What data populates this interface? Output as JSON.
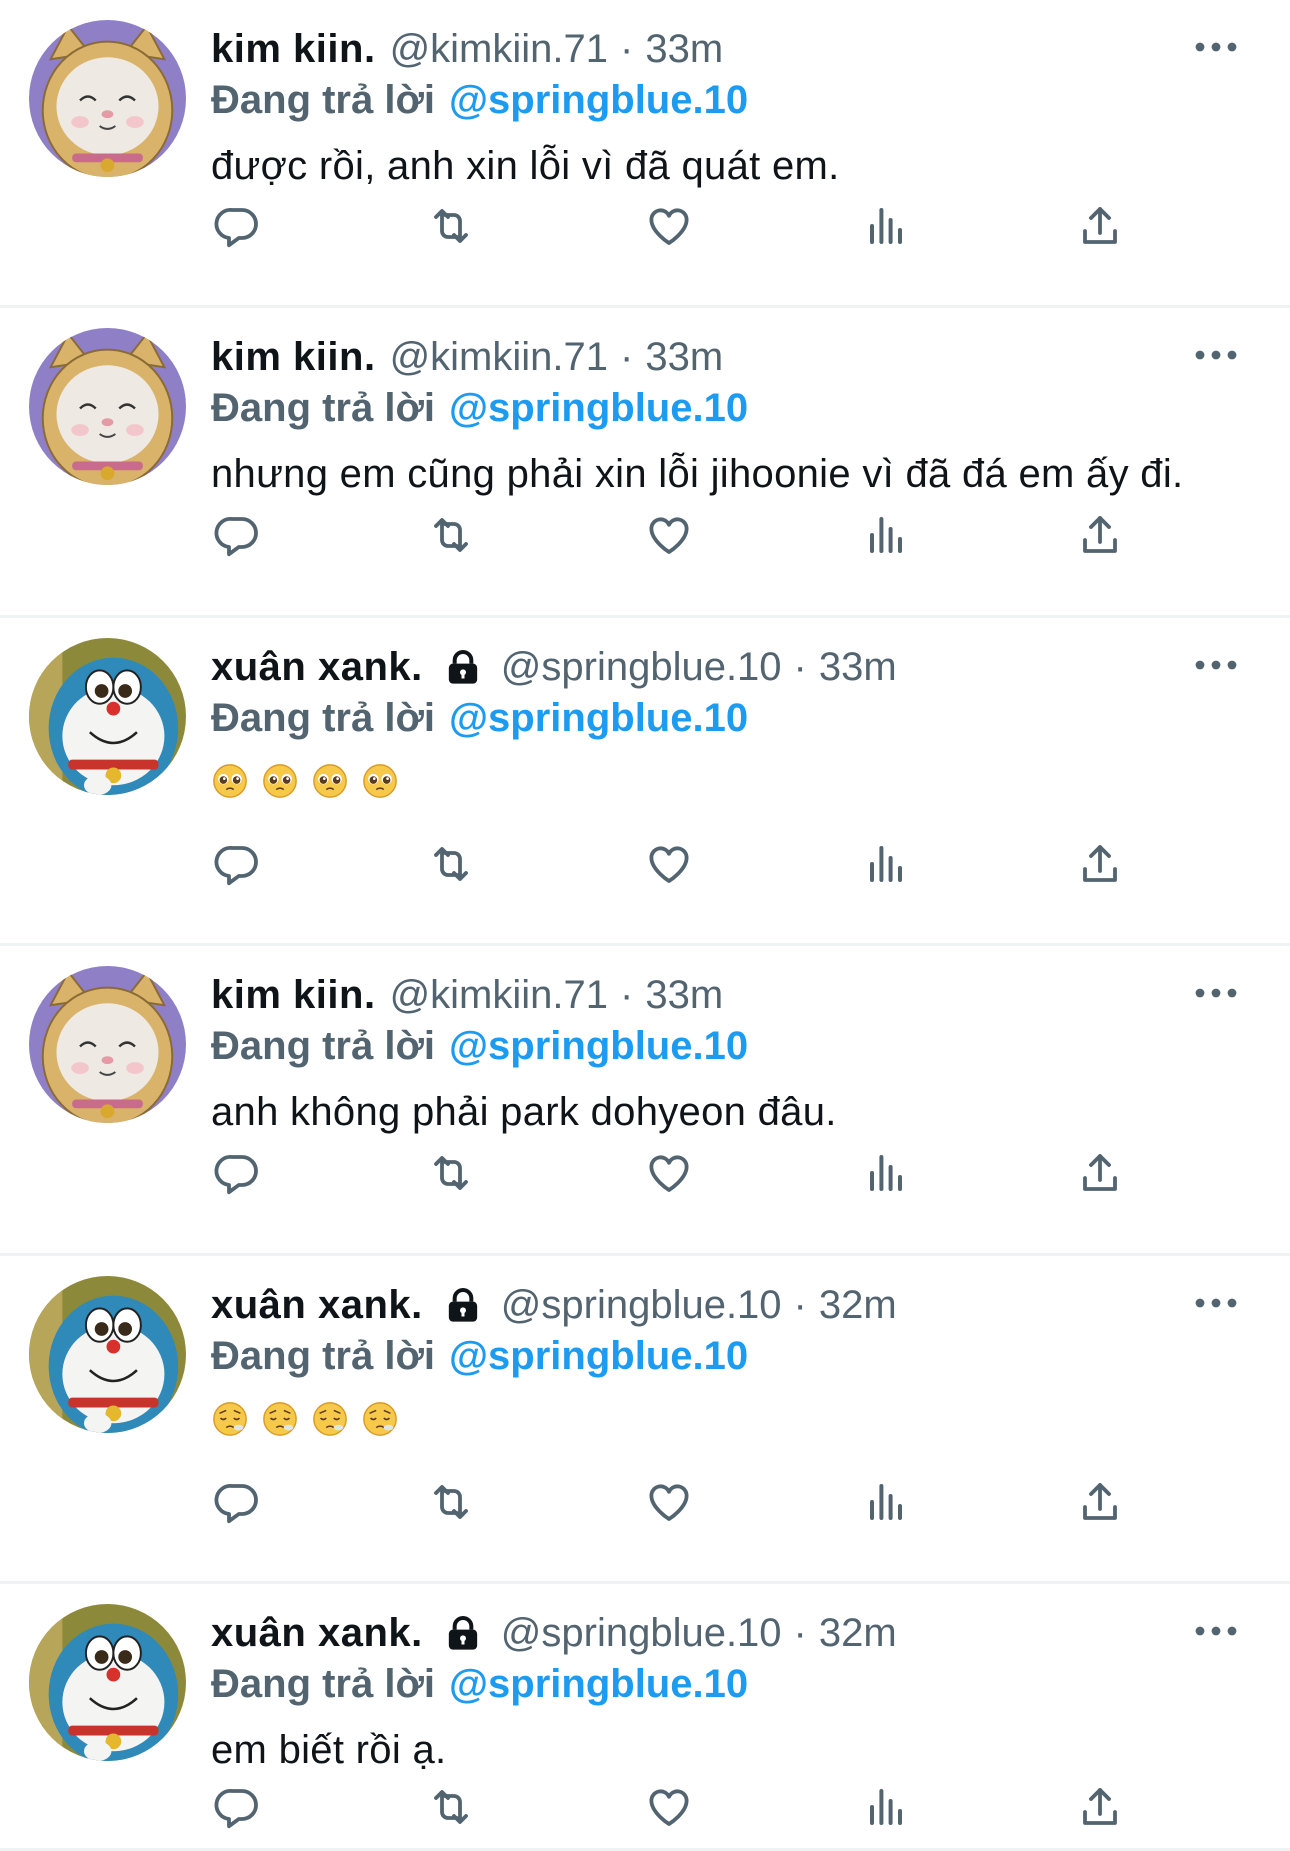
{
  "theme": {
    "text": "#0f1419",
    "secondary": "#536471",
    "link": "#1d9bf0",
    "divider": "#eff3f4"
  },
  "tweets": [
    {
      "avatar": "kitten-avatar",
      "display_name": "kim kiin.",
      "locked": false,
      "handle": "@kimkiin.71",
      "dot": "·",
      "time": "33m",
      "reply_label": "Đang trả lời",
      "reply_to": "@springblue.10",
      "text": "được rồi, anh xin lỗi vì đã quát em.",
      "emojis": []
    },
    {
      "avatar": "kitten-avatar",
      "display_name": "kim kiin.",
      "locked": false,
      "handle": "@kimkiin.71",
      "dot": "·",
      "time": "33m",
      "reply_label": "Đang trả lời",
      "reply_to": "@springblue.10",
      "text": "nhưng em cũng phải xin lỗi jihoonie vì đã đá em ấy đi.",
      "emojis": []
    },
    {
      "avatar": "doraemon-avatar",
      "display_name": "xuân xank.",
      "locked": true,
      "handle": "@springblue.10",
      "dot": "·",
      "time": "33m",
      "reply_label": "Đang trả lời",
      "reply_to": "@springblue.10",
      "text": "",
      "emojis": [
        "pleading-face",
        "pleading-face",
        "pleading-face",
        "pleading-face"
      ]
    },
    {
      "avatar": "kitten-avatar",
      "display_name": "kim kiin.",
      "locked": false,
      "handle": "@kimkiin.71",
      "dot": "·",
      "time": "33m",
      "reply_label": "Đang trả lời",
      "reply_to": "@springblue.10",
      "text": "anh không phải park dohyeon đâu.",
      "emojis": []
    },
    {
      "avatar": "doraemon-avatar",
      "display_name": "xuân xank.",
      "locked": true,
      "handle": "@springblue.10",
      "dot": "·",
      "time": "32m",
      "reply_label": "Đang trả lời",
      "reply_to": "@springblue.10",
      "text": "",
      "emojis": [
        "sad-relieved-face",
        "sad-relieved-face",
        "sad-relieved-face",
        "sad-relieved-face"
      ]
    },
    {
      "avatar": "doraemon-avatar",
      "display_name": "xuân xank.",
      "locked": true,
      "handle": "@springblue.10",
      "dot": "·",
      "time": "32m",
      "reply_label": "Đang trả lời",
      "reply_to": "@springblue.10",
      "text": "em biết rồi ạ.",
      "emojis": []
    }
  ],
  "icons": {
    "more": "more-horizontal-icon",
    "reply": "reply-icon",
    "retweet": "retweet-icon",
    "like": "heart-icon",
    "views": "views-icon",
    "share": "share-icon",
    "lock": "lock-icon"
  }
}
